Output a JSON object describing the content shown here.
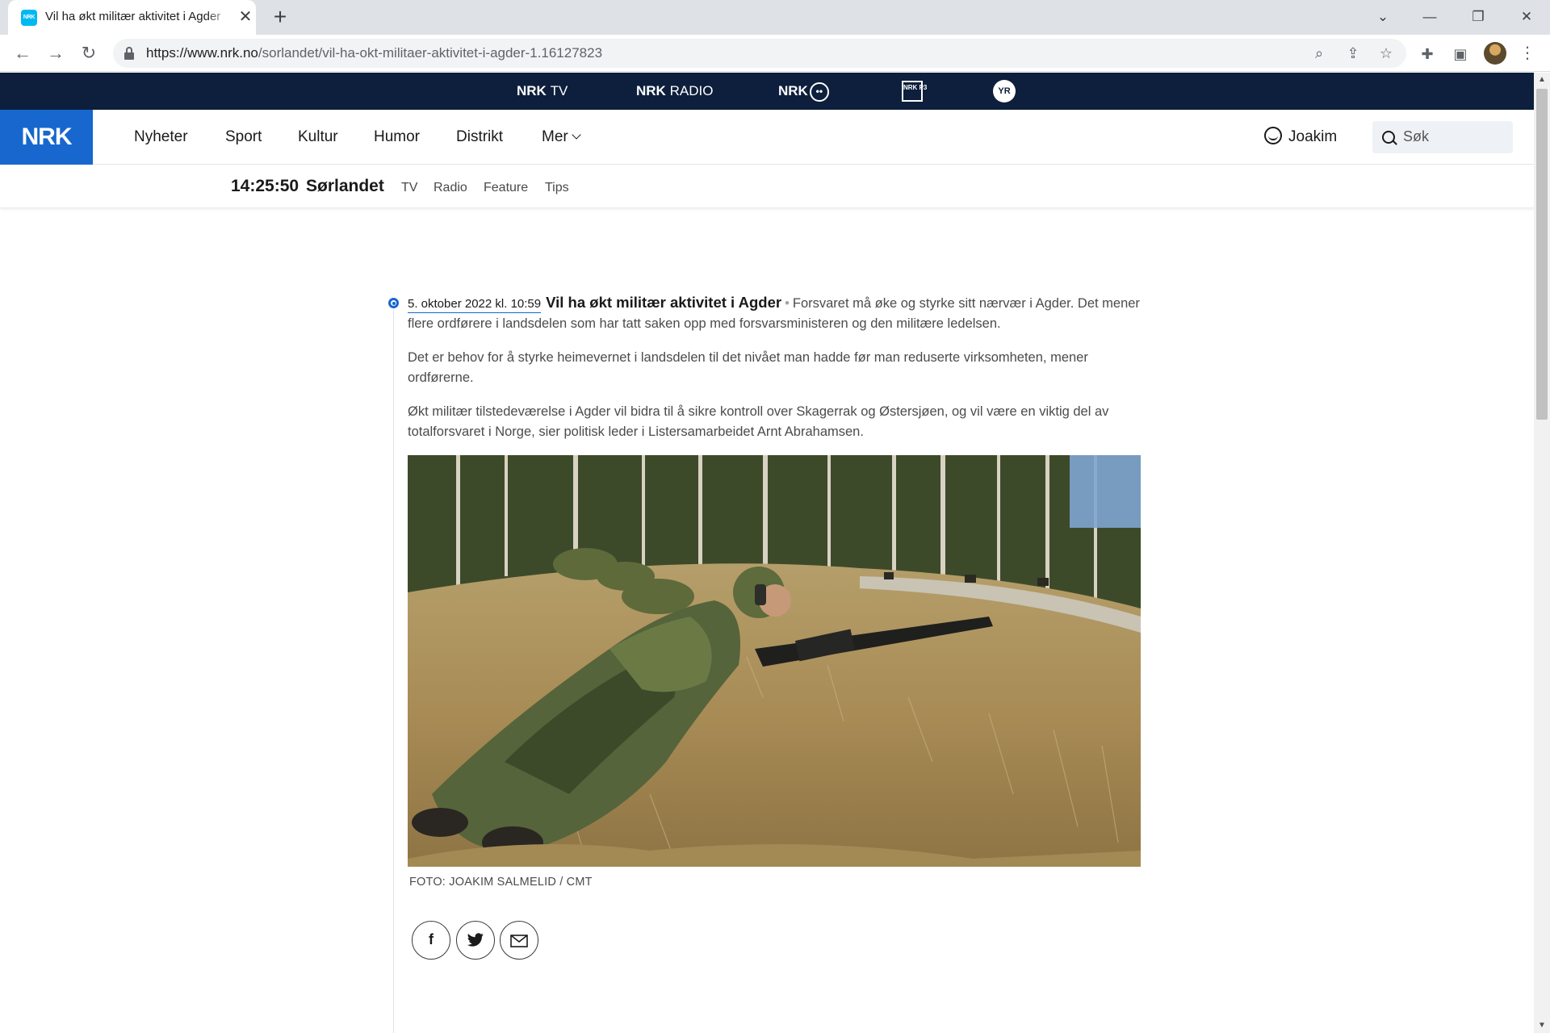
{
  "browser": {
    "tab_title": "Vil ha økt militær aktivitet i Agder",
    "tab_favicon_text": "NRK",
    "url_host": "https://www.nrk.no",
    "url_path": "/sorlandet/vil-ha-okt-militaer-aktivitet-i-agder-1.16127823"
  },
  "service_bar": {
    "tv_brand": "NRK",
    "tv_label": "TV",
    "radio_brand": "NRK",
    "radio_label": "RADIO",
    "super_brand": "NRK",
    "p3_label": "NRK P3",
    "yr_label": "YR",
    "background": "#0d1f3c"
  },
  "header": {
    "logo": "NRK",
    "logo_color": "#1767ce",
    "nav": [
      "Nyheter",
      "Sport",
      "Kultur",
      "Humor",
      "Distrikt",
      "Mer"
    ],
    "user_name": "Joakim",
    "search_placeholder": "Søk"
  },
  "subheader": {
    "time": "14:25:50",
    "region": "Sørlandet",
    "links": [
      "TV",
      "Radio",
      "Feature",
      "Tips"
    ]
  },
  "article": {
    "date": "5. oktober 2022 kl. 10:59",
    "headline": "Vil ha økt militær aktivitet i Agder",
    "lead": "Forsvaret må øke og styrke sitt nærvær i Agder. Det mener flere ordførere i landsdelen som har tatt saken opp med forsvarsministeren og den militære ledelsen.",
    "paragraphs": [
      "Det er behov for å styrke heimevernet i landsdelen til det nivået man hadde før man reduserte virksomheten, mener ordførerne.",
      "Økt militær tilstedeværelse i Agder vil bidra til å sikre kontroll over Skagerrak og Østersjøen, og vil være en viktig del av totalforsvaret i Norge, sier politisk leder i Listersamarbeidet Arnt Abrahamsen."
    ],
    "photo_caption": "FOTO: JOAKIM SALMELID / CMT",
    "share": {
      "facebook_icon": "f",
      "twitter_icon": "twitter-bird",
      "email_icon": "envelope"
    }
  }
}
